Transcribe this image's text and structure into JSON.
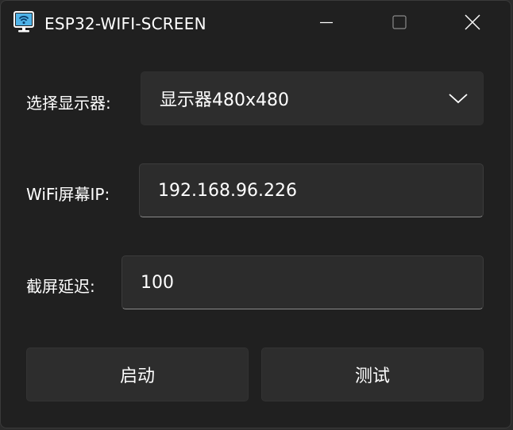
{
  "window": {
    "title": "ESP32-WIFI-SCREEN",
    "icons": {
      "app": "monitor-wifi-icon",
      "minimize": "minimize-icon",
      "maximize": "maximize-icon",
      "close": "close-icon"
    }
  },
  "form": {
    "display_label": "选择显示器:",
    "display_selected": "显示器480x480",
    "ip_label": "WiFi屏幕IP:",
    "ip_value": "192.168.96.226",
    "delay_label": "截屏延迟:",
    "delay_value": "100"
  },
  "actions": {
    "start_label": "启动",
    "test_label": "测试"
  },
  "colors": {
    "background": "#202020",
    "field": "#2d2d2d",
    "text": "#ffffff",
    "accent": "#0078d4"
  }
}
